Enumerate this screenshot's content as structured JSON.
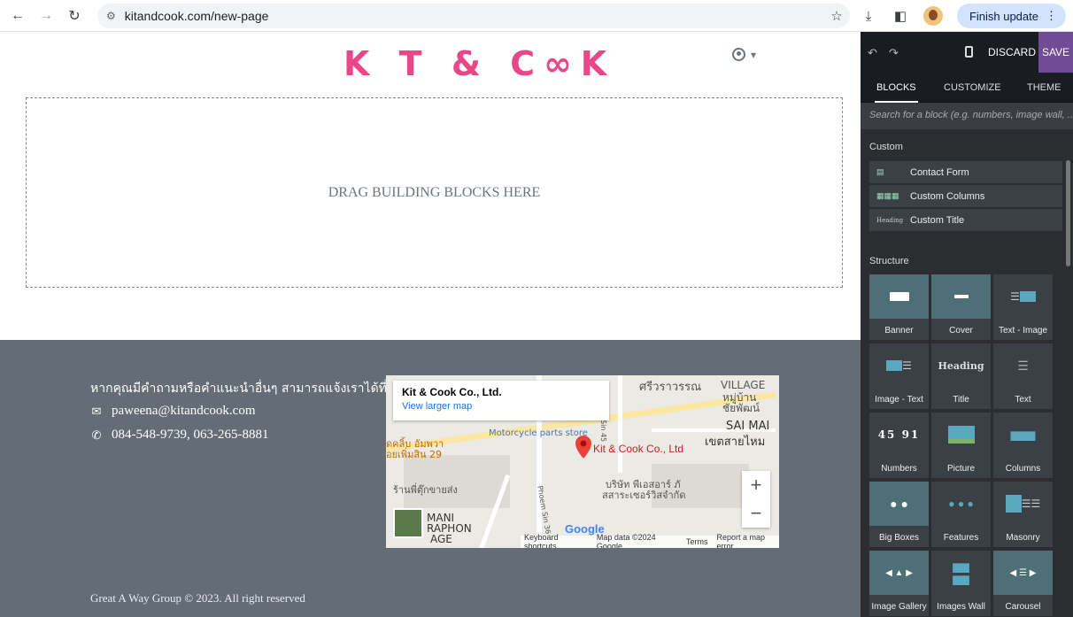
{
  "browser": {
    "url": "kitandcook.com/new-page",
    "finish_update": "Finish update"
  },
  "site": {
    "logo": "K T & C∞K",
    "dropzone_text": "DRAG BUILDING BLOCKS HERE",
    "footer": {
      "contact_title": "หากคุณมีคำถามหรือคำแนะนำอื่นๆ สามารถแจ้งเราได้ที่นี่",
      "email": "paweena@kitandcook.com",
      "phone": "084-548-9739, 063-265-8881",
      "copyright": "Great A Way Group © 2023. All right reserved"
    },
    "map": {
      "place_name": "Kit & Cook Co., Ltd.",
      "larger_map": "View larger map",
      "pin_label": "Kit & Cook Co., Ltd",
      "labels": [
        "ศรีวราวรรณ",
        "VILLAGE",
        "หมู่บ้าน",
        "ชัยพัฒน์",
        "SAI MAI",
        "เขตสายไหม",
        "Motorcycle parts store",
        "บริษัท พีเอสอาร์ ภั",
        "สสาระเซอร์วิสจำกัด",
        "ร้านพี่ตุ๊กขายส่ง",
        "ดคลิ้บ อัมพวา",
        "อยเพิ่มสิน 29",
        "MANI",
        "RAPHON",
        "AGE",
        "Phoem Sin 45",
        "Phoem Sin 36",
        "Google"
      ],
      "footer_items": [
        "Keyboard shortcuts",
        "Map data ©2024 Google",
        "Terms",
        "Report a map error"
      ]
    }
  },
  "editor": {
    "discard": "DISCARD",
    "save": "SAVE",
    "tabs": [
      "BLOCKS",
      "CUSTOMIZE",
      "THEME"
    ],
    "search_placeholder": "Search for a block (e.g. numbers, image wall, ...)",
    "custom_title": "Custom",
    "custom_items": [
      "Contact Form",
      "Custom Columns",
      "Custom Title"
    ],
    "structure_title": "Structure",
    "structure_blocks": [
      "Banner",
      "Cover",
      "Text - Image",
      "Image - Text",
      "Title",
      "Text",
      "Numbers",
      "Picture",
      "Columns",
      "Big Boxes",
      "Features",
      "Masonry",
      "Image Gallery",
      "Images Wall",
      "Carousel"
    ],
    "heading_glyph": "Heading",
    "numbers_glyph": "45 91"
  }
}
